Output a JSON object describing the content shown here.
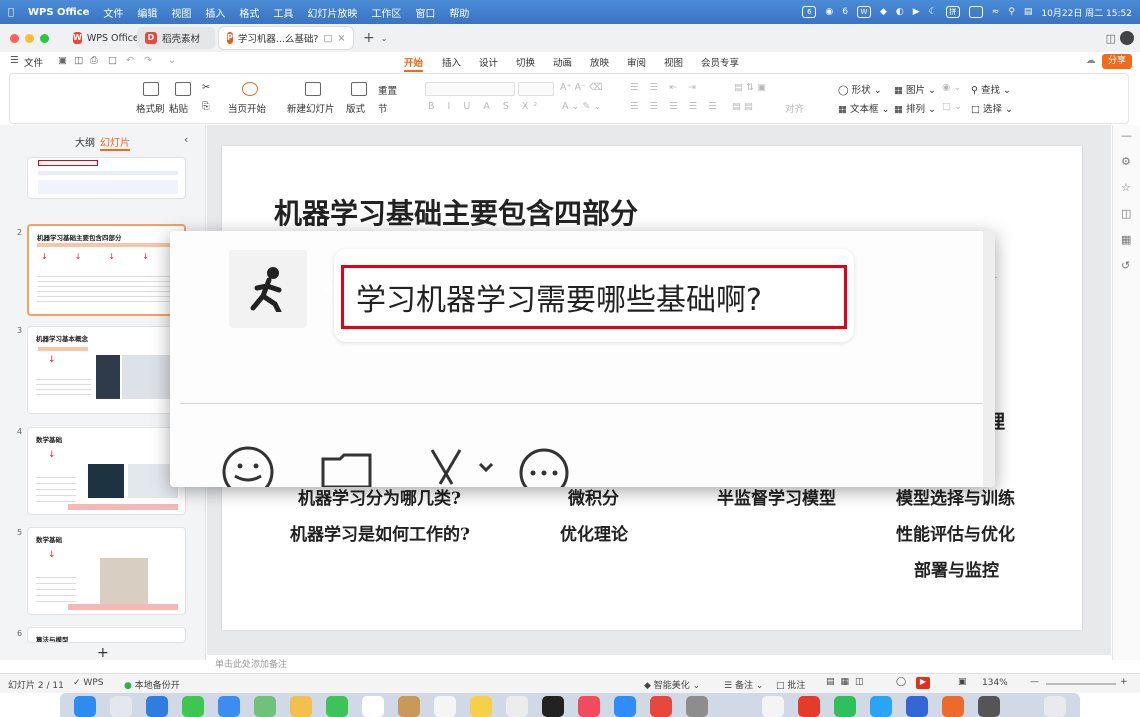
{
  "menubar": {
    "app": "WPS Office",
    "items": [
      "文件",
      "编辑",
      "视图",
      "插入",
      "格式",
      "工具",
      "幻灯片放映",
      "工作区",
      "窗口",
      "帮助"
    ],
    "right": [
      "6",
      "6"
    ],
    "datetime": "10月22日 周二 15:52"
  },
  "tabs": [
    {
      "label": "WPS Office",
      "icon": "W",
      "color": "#e8483b"
    },
    {
      "label": "稻壳素材",
      "icon": "D",
      "color": "#e8483b"
    },
    {
      "label": "学习机器...么基础?",
      "icon": "P",
      "color": "#e95a21"
    }
  ],
  "ribbon": {
    "file": "文件",
    "tabs": [
      "开始",
      "插入",
      "设计",
      "切换",
      "动画",
      "放映",
      "审阅",
      "视图",
      "会员专享"
    ],
    "share": "分享"
  },
  "toolbar": {
    "format_painter": "格式刷",
    "paste": "粘贴",
    "from_start": "当页开始",
    "new_slide": "新建幻灯片",
    "layout": "版式",
    "section": "节",
    "reset": "重置",
    "shape": "形状",
    "picture": "图片",
    "textbox": "文本框",
    "arrange": "排列",
    "find": "查找",
    "select": "选择",
    "align": "对齐"
  },
  "panel": {
    "outline": "大纲",
    "slides": "幻灯片",
    "add": "+"
  },
  "thumbs": [
    {
      "num": "2",
      "title": "机器学习基础主要包含四部分"
    },
    {
      "num": "3",
      "title": "机器学习基本概念"
    },
    {
      "num": "4",
      "title": "数学基础"
    },
    {
      "num": "5",
      "title": "数学基础"
    },
    {
      "num": "6",
      "title": "算法与模型"
    }
  ],
  "slide": {
    "title": "机器学习基础主要包含四部分",
    "col1": [
      "机器学习分为哪几类?",
      "机器学习是如何工作的?"
    ],
    "col2": [
      "微积分",
      "优化理论"
    ],
    "col3": [
      "半监督学习模型"
    ],
    "col4": [
      "模型选择与训练",
      "性能评估与优化",
      "部署与监控"
    ],
    "partial_right": "理"
  },
  "popup": {
    "question": "学习机器学习需要哪些基础啊?"
  },
  "notes_placeholder": "单击此处添加备注",
  "status": {
    "slide_count": "幻灯片 2 / 11",
    "wps": "WPS",
    "backup": "本地备份开",
    "beautify": "智能美化",
    "notes": "备注",
    "comments": "批注",
    "zoom": "134%"
  },
  "colors": {
    "accent": "#f06a1b",
    "highlight": "#e60012"
  }
}
